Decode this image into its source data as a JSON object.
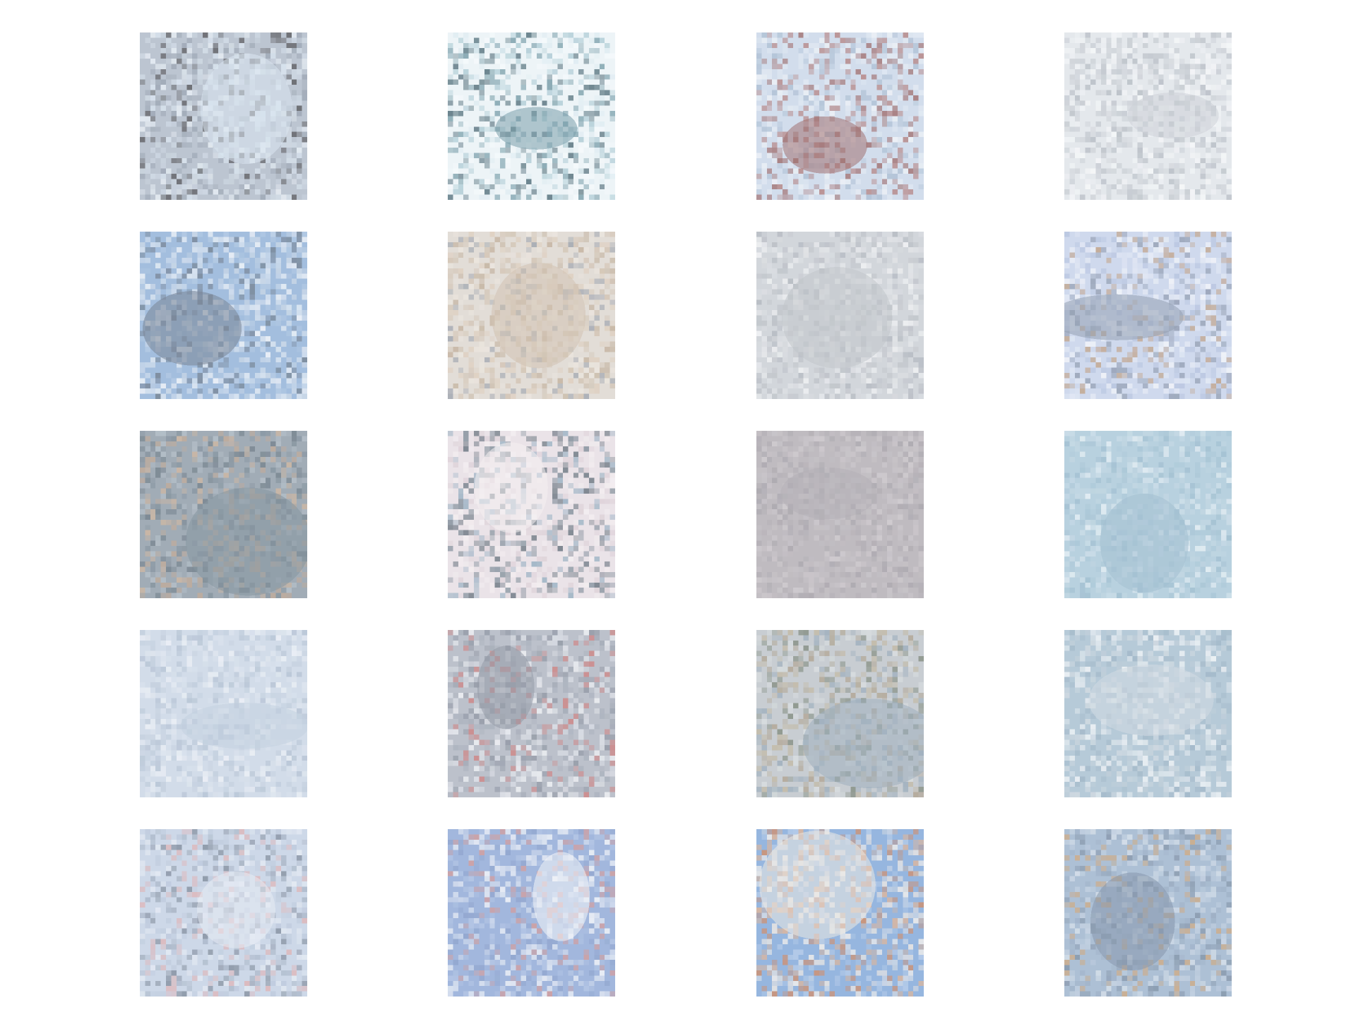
{
  "grid": {
    "rows": 5,
    "cols": 4
  },
  "tiles": [
    {
      "name": "sample-1-1",
      "bg": "#aeb9c7",
      "tones": [
        "#c6d2e0",
        "#d4e1ee",
        "#3f3f44",
        "#e4ecf4",
        "#8a96a6"
      ]
    },
    {
      "name": "sample-1-2",
      "bg": "#e9f2f6",
      "tones": [
        "#f4f9fb",
        "#5f8b99",
        "#2d4f5d",
        "#d8e8ef",
        "#9fc2cd"
      ]
    },
    {
      "name": "sample-1-3",
      "bg": "#c8d6e8",
      "tones": [
        "#dde6f1",
        "#8e5454",
        "#a76f6f",
        "#edf1f6",
        "#9fb4cc"
      ]
    },
    {
      "name": "sample-1-4",
      "bg": "#dfe3e8",
      "tones": [
        "#eef1f4",
        "#c2c8cf",
        "#b5bcc4",
        "#f5f7f9",
        "#a8b0b9"
      ]
    },
    {
      "name": "sample-2-1",
      "bg": "#8fb0d7",
      "tones": [
        "#e3ebf4",
        "#5c6c80",
        "#a5c0df",
        "#f2f5f9",
        "#c4d3e4"
      ]
    },
    {
      "name": "sample-2-2",
      "bg": "#dcd6cf",
      "tones": [
        "#8d94a0",
        "#c9b7a3",
        "#e8e1d8",
        "#b9a58e",
        "#d7c6b3"
      ]
    },
    {
      "name": "sample-2-3",
      "bg": "#c9cdd3",
      "tones": [
        "#e0e3e7",
        "#b4b9c0",
        "#eff1f3",
        "#a6acb5",
        "#d3d7dc"
      ]
    },
    {
      "name": "sample-2-4",
      "bg": "#c5d1ea",
      "tones": [
        "#dfe6f3",
        "#7e8ca3",
        "#f0f3f9",
        "#b59273",
        "#a9b9d9"
      ]
    },
    {
      "name": "sample-3-1",
      "bg": "#8d9aa6",
      "tones": [
        "#b59a85",
        "#6e7f8d",
        "#a7b4bf",
        "#c7a98f",
        "#5b6b78"
      ]
    },
    {
      "name": "sample-3-2",
      "bg": "#e6dde3",
      "tones": [
        "#4d5b68",
        "#f2ecef",
        "#83a0b6",
        "#d6c8d0",
        "#6a7a88"
      ]
    },
    {
      "name": "sample-3-3",
      "bg": "#b1acb2",
      "tones": [
        "#bfbac0",
        "#a4a0a7",
        "#c8c3c8",
        "#9a969e",
        "#b8b3b9"
      ]
    },
    {
      "name": "sample-3-4",
      "bg": "#a9c7d8",
      "tones": [
        "#c3d8e5",
        "#8fb3c8",
        "#e2edf3",
        "#9dbfd2",
        "#b6cfdd"
      ]
    },
    {
      "name": "sample-4-1",
      "bg": "#c9d5e4",
      "tones": [
        "#dbe3ee",
        "#b7c6d8",
        "#e9eef5",
        "#a9b9cd",
        "#d2dcea"
      ]
    },
    {
      "name": "sample-4-2",
      "bg": "#aeb4c0",
      "tones": [
        "#d9dde5",
        "#7d8594",
        "#eef0f4",
        "#c46d6d",
        "#9aa2b0"
      ]
    },
    {
      "name": "sample-4-3",
      "bg": "#bcc3c8",
      "tones": [
        "#a2947f",
        "#8a9eb0",
        "#d2d7da",
        "#6f7a6d",
        "#b7ab94"
      ]
    },
    {
      "name": "sample-4-4",
      "bg": "#a7bfd0",
      "tones": [
        "#e6ecf1",
        "#c9d4dc",
        "#8fa9bd",
        "#f1f4f7",
        "#b3c5d2"
      ]
    },
    {
      "name": "sample-5-1",
      "bg": "#c3d0e3",
      "tones": [
        "#6e7b8e",
        "#e1e8f2",
        "#98a7bc",
        "#d7a6a9",
        "#b1c0d6"
      ]
    },
    {
      "name": "sample-5-2",
      "bg": "#8ea8d6",
      "tones": [
        "#a6bbe0",
        "#f2f4f8",
        "#c98a8a",
        "#7a93c4",
        "#dfe6f2"
      ]
    },
    {
      "name": "sample-5-3",
      "bg": "#7fa6d8",
      "tones": [
        "#d8a685",
        "#e9e3dd",
        "#c7784f",
        "#a9c3e5",
        "#f1ede8"
      ]
    },
    {
      "name": "sample-5-4",
      "bg": "#9cb2cc",
      "tones": [
        "#b8c9dc",
        "#6e829a",
        "#d0dbe7",
        "#8da3bd",
        "#c59a6c"
      ]
    }
  ]
}
